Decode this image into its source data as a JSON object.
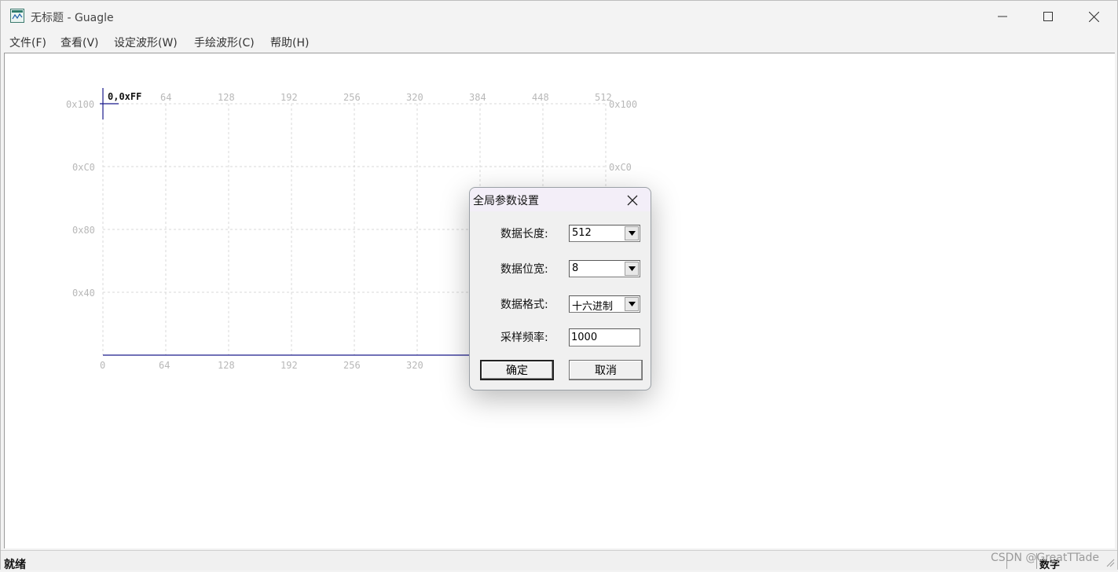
{
  "window": {
    "title": "无标题 - Guagle"
  },
  "menu": [
    {
      "label": "文件(F)"
    },
    {
      "label": "查看(V)"
    },
    {
      "label": "设定波形(W)"
    },
    {
      "label": "手绘波形(C)"
    },
    {
      "label": "帮助(H)"
    }
  ],
  "plot": {
    "cursor_label": "0,0xFF",
    "x_ticks_top": [
      "64",
      "128",
      "192",
      "256",
      "320",
      "384",
      "448",
      "512"
    ],
    "x_ticks_bottom": [
      "0",
      "64",
      "128",
      "192",
      "256",
      "320"
    ],
    "y_ticks_left": [
      "0x100",
      "0xC0",
      "0x80",
      "0x40"
    ],
    "y_ticks_right": [
      "0x100",
      "0xC0"
    ],
    "line_color": "#1a1a8c",
    "grid_color": "#d9d9d9"
  },
  "dialog": {
    "title": "全局参数设置",
    "length_label": "数据长度:",
    "length_value": "512",
    "width_label": "数据位宽:",
    "width_value": "8",
    "format_label": "数据格式:",
    "format_value": "十六进制",
    "rate_label": "采样频率:",
    "rate_value": "1000",
    "ok_label": "确定",
    "cancel_label": "取消"
  },
  "status": {
    "ready": "就绪",
    "num": "数字"
  },
  "watermark": "CSDN @GreatTTade"
}
